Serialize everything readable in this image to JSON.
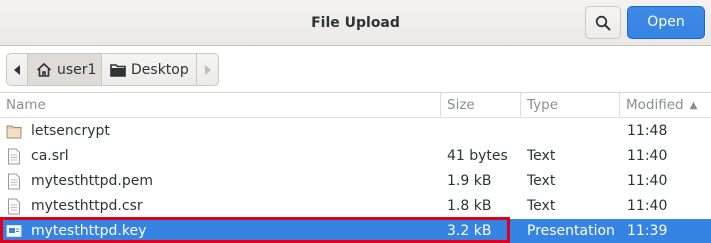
{
  "dialog": {
    "title": "File Upload",
    "open_label": "Open",
    "search_icon": "search-icon"
  },
  "pathbar": {
    "crumbs": [
      {
        "label": "user1",
        "icon": "home-icon"
      },
      {
        "label": "Desktop",
        "icon": "folder-icon"
      }
    ]
  },
  "columns": {
    "name": "Name",
    "size": "Size",
    "type": "Type",
    "modified": "Modified"
  },
  "files": [
    {
      "name": "letsencrypt",
      "size": "",
      "type": "",
      "modified": "11:48",
      "icon": "folder-icon"
    },
    {
      "name": "ca.srl",
      "size": "41 bytes",
      "type": "Text",
      "modified": "11:40",
      "icon": "text-file-icon"
    },
    {
      "name": "mytesthttpd.pem",
      "size": "1.9 kB",
      "type": "Text",
      "modified": "11:40",
      "icon": "text-file-icon"
    },
    {
      "name": "mytesthttpd.csr",
      "size": "1.8 kB",
      "type": "Text",
      "modified": "11:40",
      "icon": "text-file-icon"
    },
    {
      "name": "mytesthttpd.key",
      "size": "3.2 kB",
      "type": "Presentation",
      "modified": "11:39",
      "icon": "presentation-file-icon",
      "selected": true
    }
  ],
  "colors": {
    "accent": "#3584e4",
    "highlight_box": "#e0001b"
  }
}
